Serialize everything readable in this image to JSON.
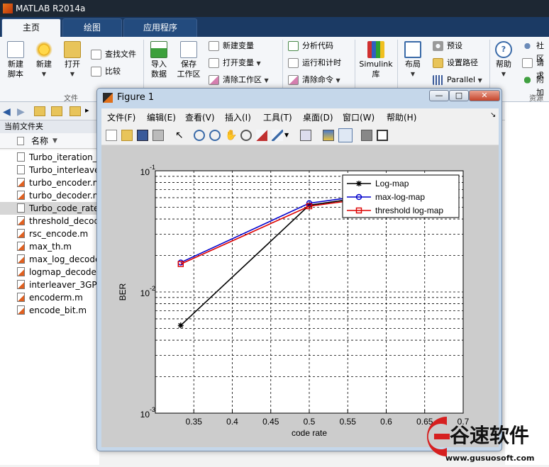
{
  "app": {
    "title": "MATLAB R2014a"
  },
  "tabs": [
    {
      "label": "主页"
    },
    {
      "label": "绘图"
    },
    {
      "label": "应用程序"
    }
  ],
  "ribbon": {
    "new_script": "新建\n脚本",
    "new": "新建",
    "open": "打开",
    "find_files": "查找文件",
    "compare": "比较",
    "file_group": "文件",
    "import_data": "导入\n数据",
    "save_workspace": "保存\n工作区",
    "new_variable": "新建变量",
    "open_variable": "打开变量",
    "clear_workspace": "清除工作区",
    "analyze_code": "分析代码",
    "run_and_time": "运行和计时",
    "clear_commands": "清除命令",
    "simulink": "Simulink\n库",
    "layout": "布局",
    "preferences": "预设",
    "set_path": "设置路径",
    "parallel": "Parallel",
    "help": "帮助",
    "community": "社区",
    "request_support": "请求",
    "addons": "附加",
    "resources_group": "资源"
  },
  "browser": {
    "current_folder": "当前文件夹",
    "name_col": "名称",
    "files": [
      {
        "name": "Turbo_iteration_",
        "icon": "script-file-icon"
      },
      {
        "name": "Turbo_interleave",
        "icon": "script-file-icon"
      },
      {
        "name": "turbo_encoder.m",
        "icon": "function-file-icon"
      },
      {
        "name": "turbo_decoder.m",
        "icon": "function-file-icon"
      },
      {
        "name": "Turbo_code_rate",
        "icon": "script-file-icon",
        "selected": true
      },
      {
        "name": "threshold_decod",
        "icon": "function-file-icon"
      },
      {
        "name": "rsc_encode.m",
        "icon": "function-file-icon"
      },
      {
        "name": "max_th.m",
        "icon": "function-file-icon"
      },
      {
        "name": "max_log_decode",
        "icon": "function-file-icon"
      },
      {
        "name": "logmap_decode",
        "icon": "function-file-icon"
      },
      {
        "name": "interleaver_3GPP",
        "icon": "function-file-icon"
      },
      {
        "name": "encoderm.m",
        "icon": "function-file-icon"
      },
      {
        "name": "encode_bit.m",
        "icon": "function-file-icon"
      }
    ]
  },
  "figure": {
    "title": "Figure 1",
    "menus": [
      "文件(F)",
      "编辑(E)",
      "查看(V)",
      "插入(I)",
      "工具(T)",
      "桌面(D)",
      "窗口(W)",
      "帮助(H)"
    ],
    "window_buttons": {
      "minimize": "—",
      "maximize": "□",
      "close": "✕"
    }
  },
  "chart_data": {
    "type": "line",
    "xlabel": "code rate",
    "ylabel": "BER",
    "x_ticks": [
      0.35,
      0.4,
      0.45,
      0.5,
      0.55,
      0.6,
      0.65,
      0.7
    ],
    "y_ticks": [
      {
        "exp": "-1",
        "value": 0.1
      },
      {
        "exp": "-2",
        "value": 0.01
      },
      {
        "exp": "-3",
        "value": 0.001
      }
    ],
    "xlim": [
      0.3,
      0.7
    ],
    "ylim": [
      0.001,
      0.1
    ],
    "y_scale": "log",
    "grid": true,
    "legend_position": "top-right",
    "series": [
      {
        "name": "Log-map",
        "color": "#000000",
        "marker": "star",
        "x": [
          0.333,
          0.5,
          0.6
        ],
        "y": [
          0.0053,
          0.052,
          0.064
        ]
      },
      {
        "name": "max-log-map",
        "color": "#0000cc",
        "marker": "circle",
        "x": [
          0.333,
          0.5,
          0.6
        ],
        "y": [
          0.0175,
          0.054,
          0.066
        ]
      },
      {
        "name": "threshold log-map",
        "color": "#dd0000",
        "marker": "square",
        "x": [
          0.333,
          0.5,
          0.6
        ],
        "y": [
          0.017,
          0.051,
          0.062
        ]
      }
    ]
  },
  "watermark": {
    "brand": "谷速软件",
    "url": "www.gusuosoft.com"
  }
}
